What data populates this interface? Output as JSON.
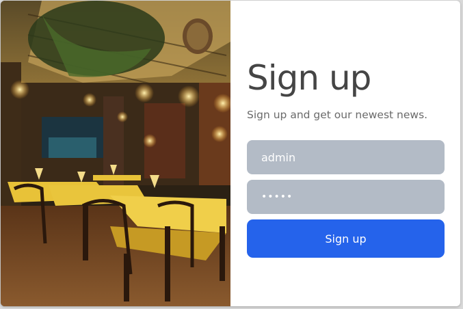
{
  "signup": {
    "title": "Sign up",
    "subtitle": "Sign up and get our newest news.",
    "username_value": "admin",
    "password_value": "admin",
    "submit_label": "Sign up"
  },
  "colors": {
    "field_bg": "#b3bbc6",
    "button_bg": "#2563eb",
    "title_text": "#454545"
  },
  "icons": {
    "hero": "restaurant-interior-photo"
  }
}
